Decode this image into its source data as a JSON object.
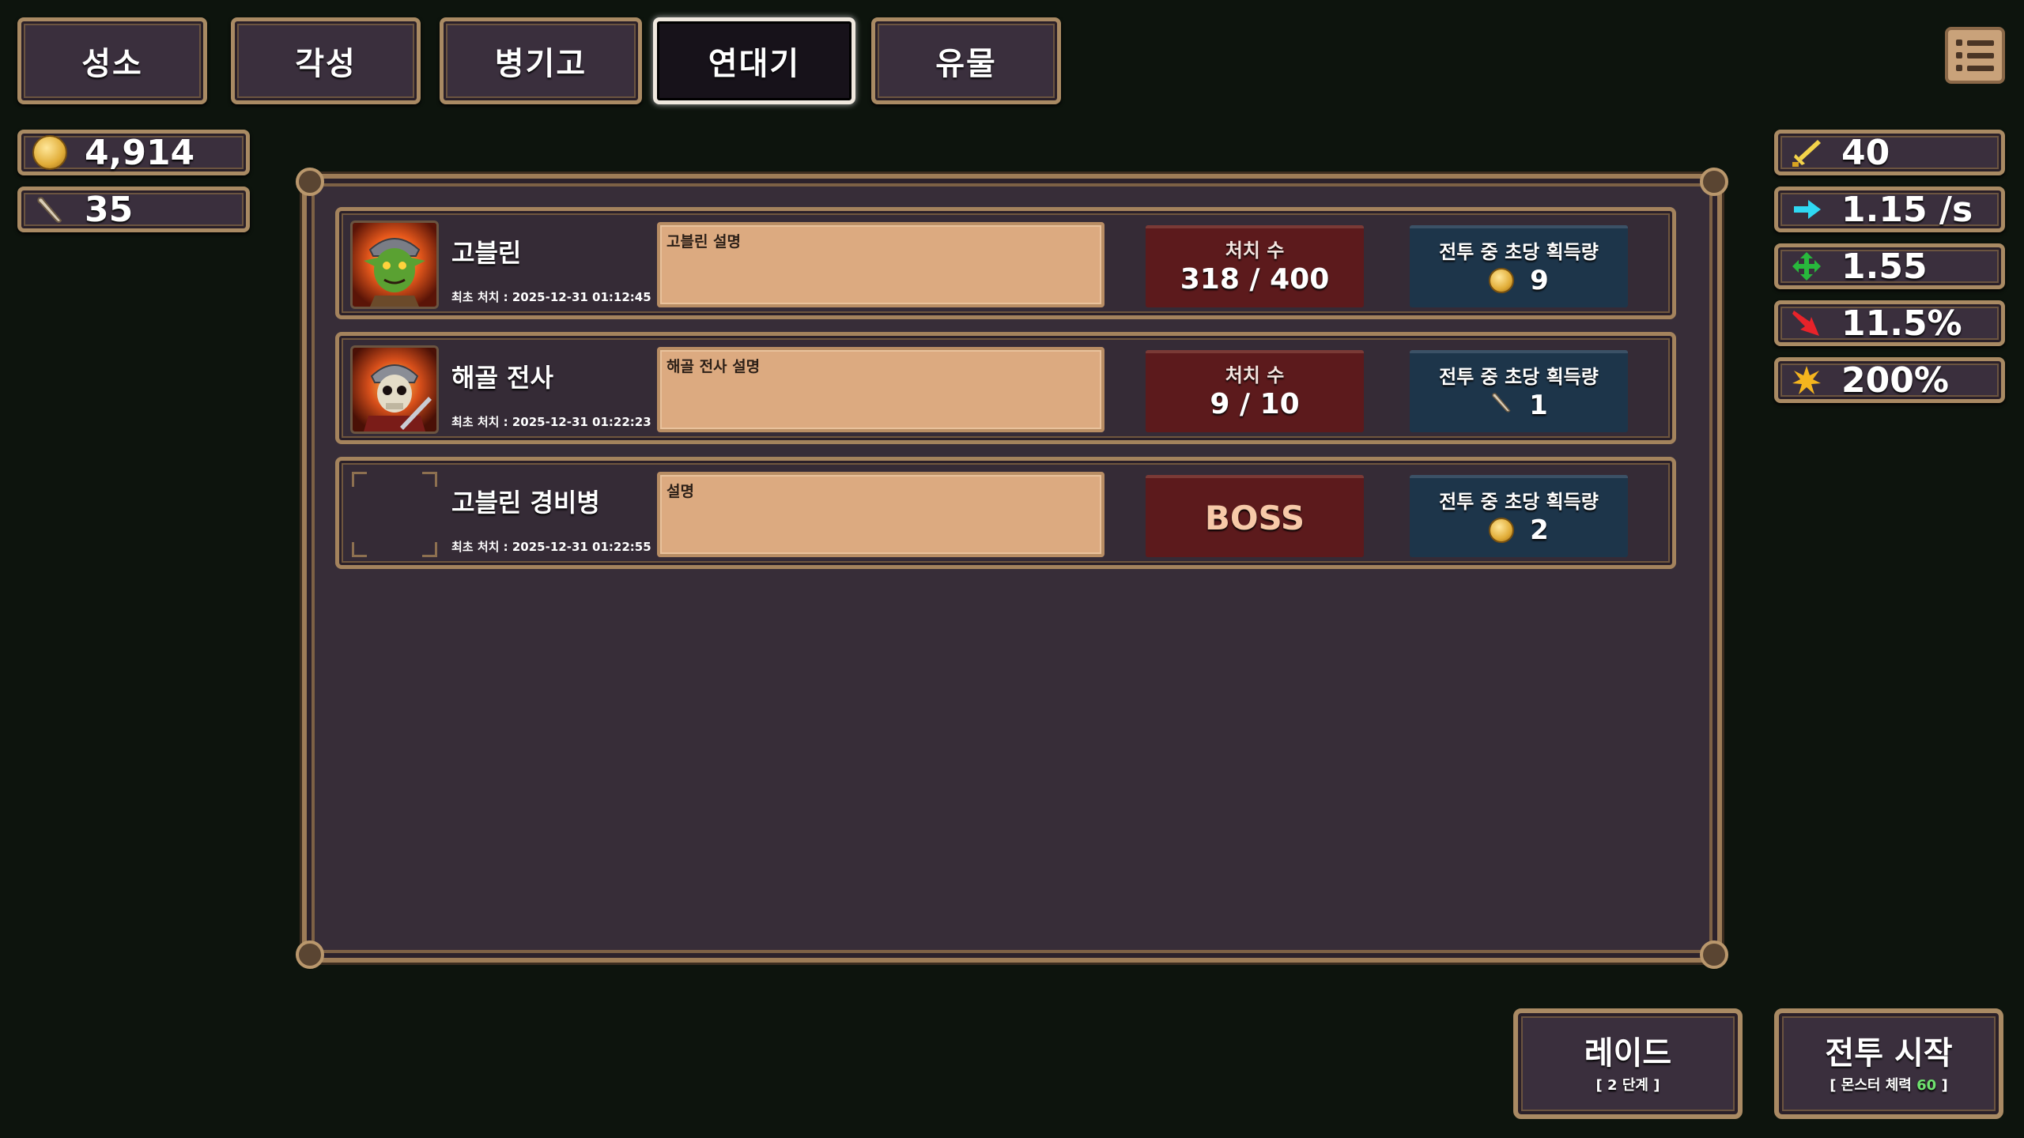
{
  "tabs": [
    {
      "label": "성소",
      "active": false
    },
    {
      "label": "각성",
      "active": false
    },
    {
      "label": "병기고",
      "active": false
    },
    {
      "label": "연대기",
      "active": true
    },
    {
      "label": "유물",
      "active": false
    }
  ],
  "menu": {
    "icon": "list-menu-icon"
  },
  "currencies": [
    {
      "icon": "gold-coin-icon",
      "value": "4,914"
    },
    {
      "icon": "bone-icon",
      "value": "35"
    }
  ],
  "stats": [
    {
      "icon": "sword-attack-icon",
      "value": "40",
      "color": "#f3d34a"
    },
    {
      "icon": "speed-arrow-icon",
      "value": "1.15 /s",
      "color": "#2fd8f2"
    },
    {
      "icon": "move-cross-icon",
      "value": "1.55",
      "color": "#28b83c"
    },
    {
      "icon": "crit-arrow-icon",
      "value": "11.5%",
      "color": "#e8232a"
    },
    {
      "icon": "burst-star-icon",
      "value": "200%",
      "color": "#f5b51e"
    }
  ],
  "monsters": [
    {
      "name": "고블린",
      "first_kill": "최초 처치 : 2025-12-31 01:12:45",
      "description": "고블린 설명",
      "kills_label": "처치 수",
      "kills_value": "318 / 400",
      "is_boss": false,
      "gain_label": "전투 중 초당 획득량",
      "gain_icon": "gold-coin-icon",
      "gain_value": "9",
      "portrait": "goblin-portrait"
    },
    {
      "name": "해골 전사",
      "first_kill": "최초 처치 : 2025-12-31 01:22:23",
      "description": "해골 전사 설명",
      "kills_label": "처치 수",
      "kills_value": "9 / 10",
      "is_boss": false,
      "gain_label": "전투 중 초당 획득량",
      "gain_icon": "bone-icon",
      "gain_value": "1",
      "portrait": "skeleton-warrior-portrait"
    },
    {
      "name": "고블린 경비병",
      "first_kill": "최초 처치 : 2025-12-31 01:22:55",
      "description": "설명",
      "boss_label": "BOSS",
      "is_boss": true,
      "gain_label": "전투 중 초당 획득량",
      "gain_icon": "gold-coin-icon",
      "gain_value": "2",
      "portrait": "empty-portrait"
    }
  ],
  "buttons": {
    "raid": {
      "label": "레이드",
      "sub": "[ 2 단계 ]"
    },
    "battle": {
      "label": "전투 시작",
      "sub_prefix": "[ 몬스터 체력 ",
      "sub_value": "60",
      "sub_suffix": " ]"
    }
  }
}
